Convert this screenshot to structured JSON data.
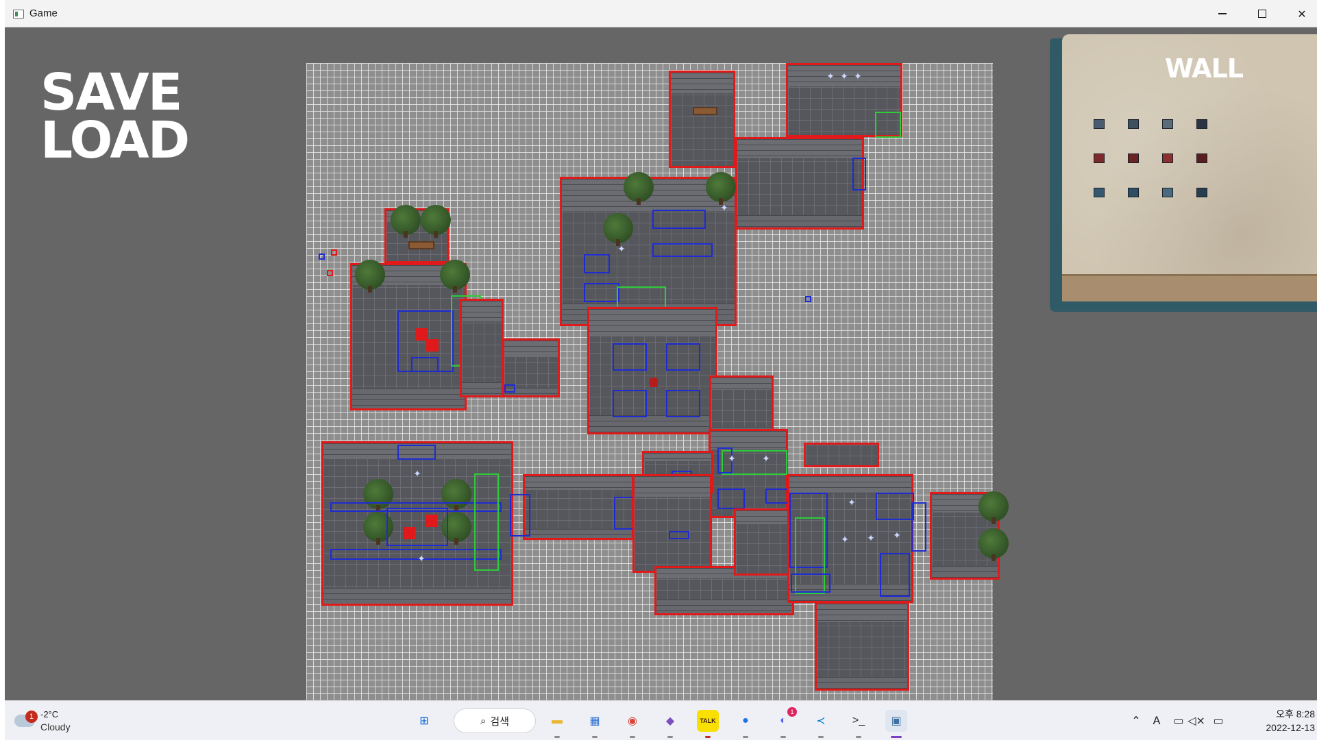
{
  "window": {
    "title": "Game"
  },
  "titlebar_buttons": {
    "minimize": "minimize-icon",
    "maximize": "maximize-icon",
    "close": "close-icon"
  },
  "menu": {
    "save": "SAVE",
    "load": "LOAD"
  },
  "wall_panel": {
    "title": "WALL",
    "tile_rows": [
      [
        "#4a5d6e",
        "#3e5060",
        "#5b6b78",
        "#2b3440"
      ],
      [
        "#7a2a2a",
        "#6a2424",
        "#8a3030",
        "#5a1d1d"
      ],
      [
        "#355870",
        "#2f4e63",
        "#4a6a80",
        "#263e4e"
      ]
    ]
  },
  "colors": {
    "room_outline": "#e01a1a",
    "collider": "#1e2bd4",
    "trigger": "#2ecb3a",
    "background": "#666666"
  },
  "taskbar": {
    "weather": {
      "badge": "1",
      "temp": "-2°C",
      "condition": "Cloudy"
    },
    "search_label": "검색",
    "apps": [
      {
        "name": "windows-start-icon",
        "glyph": "⊞",
        "color": "#0a64d6"
      },
      {
        "name": "file-explorer-icon",
        "glyph": "▬",
        "color": "#e8b630"
      },
      {
        "name": "microsoft-store-icon",
        "glyph": "▦",
        "color": "#2a6fd6"
      },
      {
        "name": "chrome-icon",
        "glyph": "◉",
        "color": "#db4437"
      },
      {
        "name": "visual-studio-icon",
        "glyph": "◆",
        "color": "#7a4fbf"
      },
      {
        "name": "kakaotalk-icon",
        "glyph": "TALK",
        "color": "#3b1e1e"
      },
      {
        "name": "maps-icon",
        "glyph": "●",
        "color": "#1a73e8"
      },
      {
        "name": "discord-icon",
        "glyph": "◐",
        "color": "#5865f2"
      },
      {
        "name": "vscode-icon",
        "glyph": "≺",
        "color": "#007acc"
      },
      {
        "name": "terminal-icon",
        "glyph": ">_",
        "color": "#2d2d2d"
      },
      {
        "name": "game-window-icon",
        "glyph": "▣",
        "color": "#3d6fa0"
      }
    ],
    "discord_badge": "1",
    "clock": {
      "time": "오후 8:28",
      "date": "2022-12-13"
    }
  }
}
